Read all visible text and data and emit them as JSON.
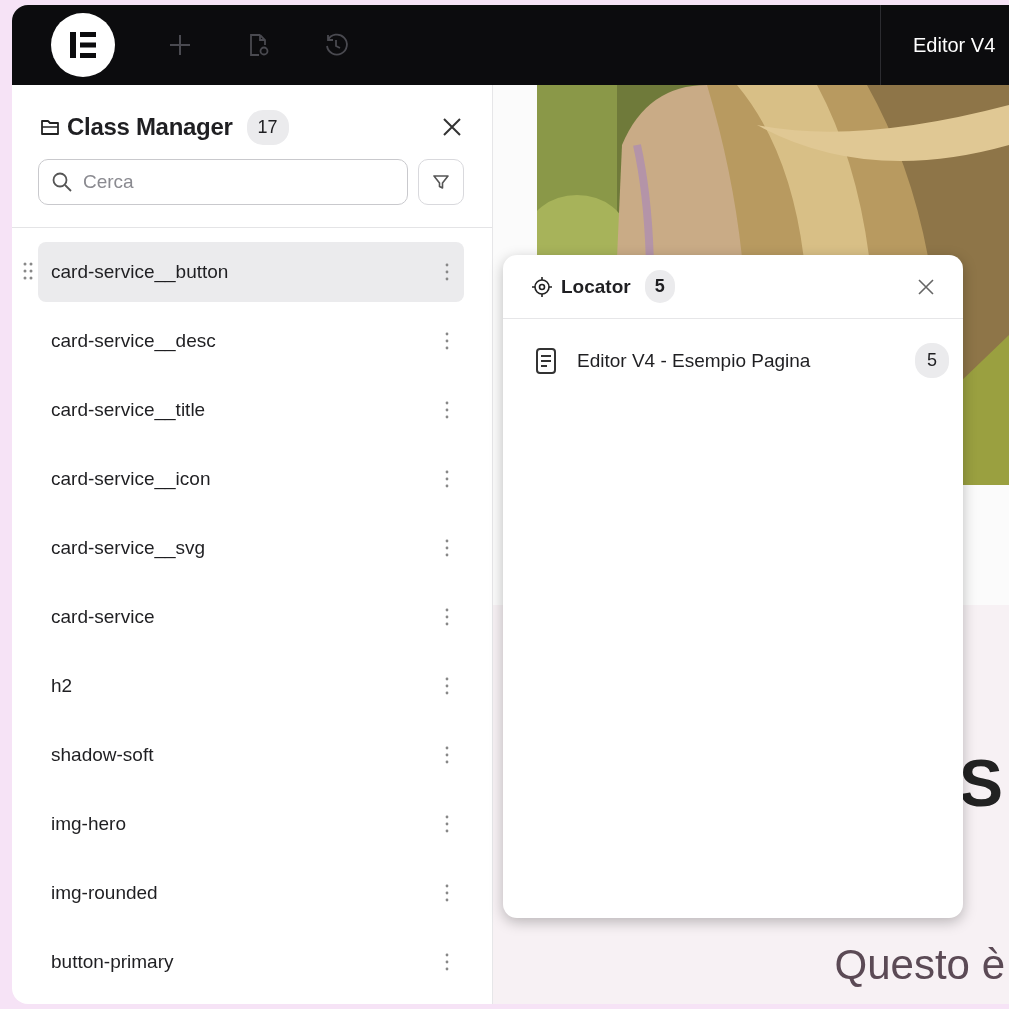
{
  "topbar": {
    "title": "Editor V4"
  },
  "class_manager": {
    "title": "Class Manager",
    "count": "17",
    "search": {
      "placeholder": "Cerca"
    },
    "items": [
      {
        "label": "card-service__button",
        "selected": true
      },
      {
        "label": "card-service__desc",
        "selected": false
      },
      {
        "label": "card-service__title",
        "selected": false
      },
      {
        "label": "card-service__icon",
        "selected": false
      },
      {
        "label": "card-service__svg",
        "selected": false
      },
      {
        "label": "card-service",
        "selected": false
      },
      {
        "label": "h2",
        "selected": false
      },
      {
        "label": "shadow-soft",
        "selected": false
      },
      {
        "label": "img-hero",
        "selected": false
      },
      {
        "label": "img-rounded",
        "selected": false
      },
      {
        "label": "button-primary",
        "selected": false
      }
    ]
  },
  "canvas": {
    "heading": "S",
    "text": "Questo è"
  },
  "locator": {
    "title": "Locator",
    "count": "5",
    "items": [
      {
        "label": "Editor V4 - Esempio Pagina",
        "count": "5"
      }
    ]
  }
}
